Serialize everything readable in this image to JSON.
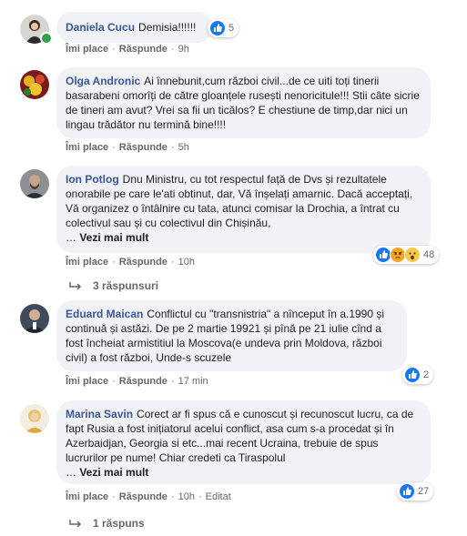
{
  "colors": {
    "author": "#385898",
    "bubble": "#f0f2f5",
    "like": "#1877f2",
    "meta": "#65676b"
  },
  "actions_labels": {
    "like": "Îmi place",
    "reply": "Răspunde",
    "edited": "Editat"
  },
  "comments": [
    {
      "author": "Daniela Cucu",
      "text": "Demisia!!!!!!",
      "time": "9h",
      "reactions": {
        "icons": [
          "like-icon"
        ],
        "count": "5"
      }
    },
    {
      "author": "Olga Andronic",
      "text": "Ai înnebunit,cum război civil...de ce uiti toți tinerii basarabeni omorîți de către gloanțele rusești nenoricitule!!! Stii câte sicrie de tineri am avut? Vrei sa fii un ticălos? E chestiune de timp,dar nici un lingau trădător nu termină bine!!!!",
      "time": "5h"
    },
    {
      "author": "Ion Potlog",
      "text": "Dnu Ministru, cu tot respectul față de Dvs și rezultatele onorabile pe care le'ati obtinut, dar, Vă înșelați amarnic. Dacă acceptați, Vă organizez o întâlnire cu tata, atunci comisar la Drochia, a întrat cu colectivul sau și cu colectivul din Chișinău,",
      "more": "Vezi mai mult",
      "time": "10h",
      "reactions": {
        "icons": [
          "like-icon",
          "angry-icon",
          "wow-icon"
        ],
        "count": "48"
      },
      "replies": "3 răspunsuri"
    },
    {
      "author": "Eduard Maican",
      "text": "Conflictul cu \"transnistria\" a nînceput în a.1990 și continuă și astăzi. De pe 2 martie 19921 și pînă pe 21 iulie cînd a fost încheiat armistitiul la Moscova(e undeva prin Moldova, război civil) a fost război, Unde-s scuzele",
      "time": "17 min",
      "reactions": {
        "icons": [
          "like-icon"
        ],
        "count": "2"
      }
    },
    {
      "author": "Marina Savin",
      "text": "Corect ar fi spus că e cunoscut și recunoscut lucru, ca de fapt Rusia a fost inițiatorul acelui conflict, asa cum s-a procedat și în Azerbaidjan, Georgia si etc...mai recent Ucraina, trebuie de spus lucrurilor pe nume! Chiar credeti ca Tiraspolul",
      "more": "Vezi mai mult",
      "time": "10h",
      "edited": true,
      "reactions": {
        "icons": [
          "like-icon"
        ],
        "count": "27"
      },
      "replies": "1 răspuns"
    }
  ]
}
